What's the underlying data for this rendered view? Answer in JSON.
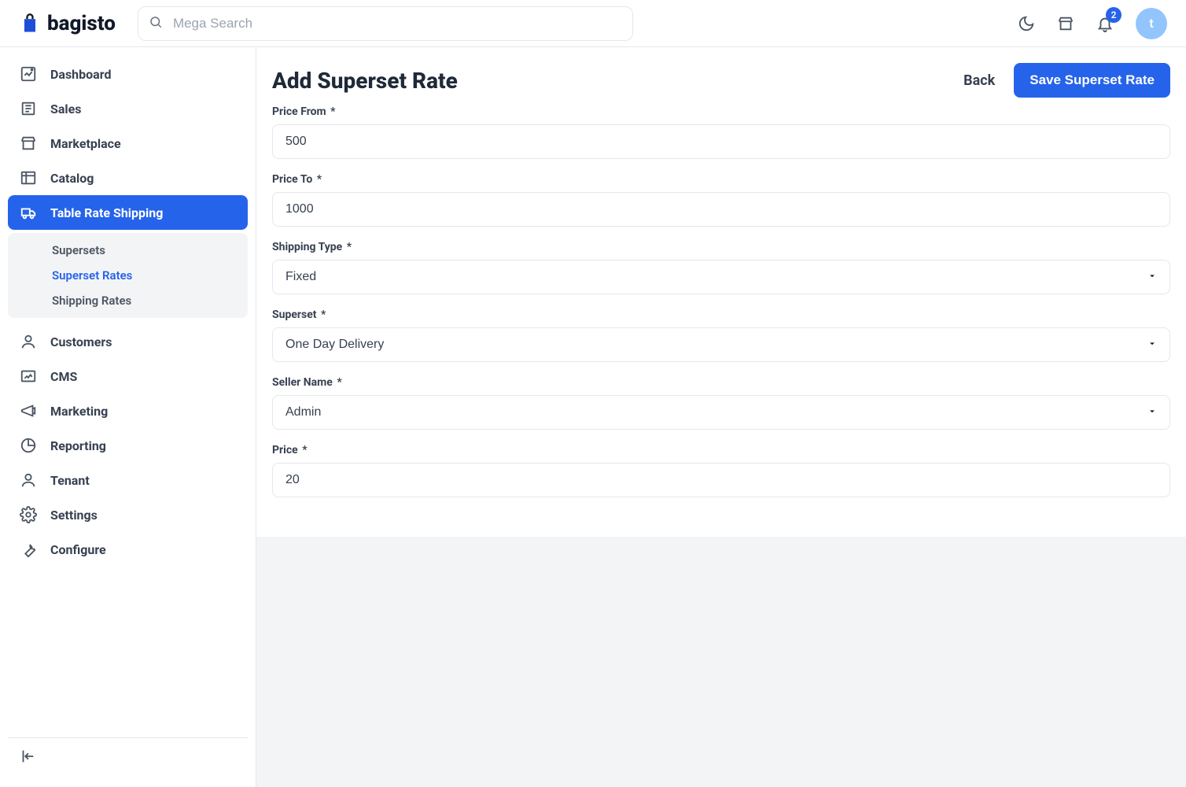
{
  "brand": {
    "name": "bagisto"
  },
  "search": {
    "placeholder": "Mega Search"
  },
  "notifications": {
    "count": "2"
  },
  "avatar": {
    "initial": "t"
  },
  "sidebar": {
    "items": [
      {
        "label": "Dashboard"
      },
      {
        "label": "Sales"
      },
      {
        "label": "Marketplace"
      },
      {
        "label": "Catalog"
      },
      {
        "label": "Table Rate Shipping"
      },
      {
        "label": "Customers"
      },
      {
        "label": "CMS"
      },
      {
        "label": "Marketing"
      },
      {
        "label": "Reporting"
      },
      {
        "label": "Tenant"
      },
      {
        "label": "Settings"
      },
      {
        "label": "Configure"
      }
    ],
    "subitems": [
      {
        "label": "Supersets"
      },
      {
        "label": "Superset Rates"
      },
      {
        "label": "Shipping Rates"
      }
    ]
  },
  "page": {
    "title": "Add Superset Rate",
    "back_label": "Back",
    "save_label": "Save Superset Rate"
  },
  "form": {
    "price_from": {
      "label": "Price From",
      "value": "500"
    },
    "price_to": {
      "label": "Price To",
      "value": "1000"
    },
    "shipping_type": {
      "label": "Shipping Type",
      "value": "Fixed"
    },
    "superset": {
      "label": "Superset",
      "value": "One Day Delivery"
    },
    "seller_name": {
      "label": "Seller Name",
      "value": "Admin"
    },
    "price": {
      "label": "Price",
      "value": "20"
    },
    "required_mark": "*"
  }
}
